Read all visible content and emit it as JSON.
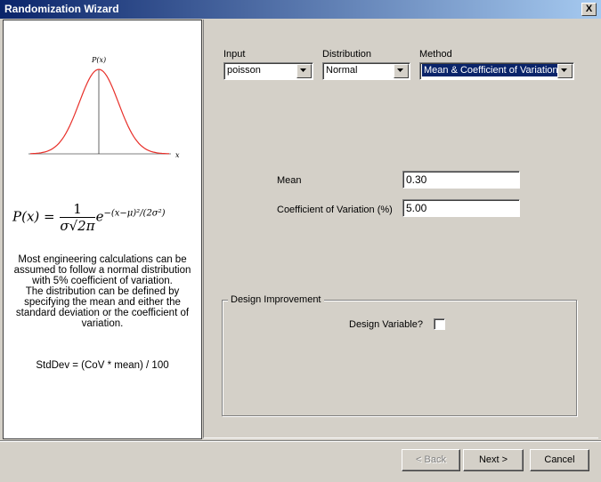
{
  "window": {
    "title": "Randomization Wizard",
    "close_glyph": "X"
  },
  "left": {
    "plot": {
      "ylabel": "P(x)",
      "xlabel": "x"
    },
    "formula": {
      "lhs": "P(x) =",
      "numerator": "1",
      "denominator": "σ√2π",
      "exp_base": "e",
      "exponent": "−(x−μ)²/(2σ²)"
    },
    "description": [
      "Most engineering calculations can be assumed to follow a normal distribution with 5% coefficient of variation.",
      "The distribution can be defined by specifying the mean and either the standard deviation or the coefficient of variation."
    ],
    "stddev_formula": "StdDev = (CoV * mean)  / 100"
  },
  "form": {
    "input": {
      "label": "Input",
      "value": "poisson"
    },
    "distribution": {
      "label": "Distribution",
      "value": "Normal"
    },
    "method": {
      "label": "Method",
      "value": "Mean & Coefficient of Variation"
    },
    "mean": {
      "label": "Mean",
      "value": "0.30"
    },
    "cov": {
      "label": "Coefficient of Variation (%)",
      "value": "5.00"
    }
  },
  "design": {
    "title": "Design Improvement",
    "checkbox_label": "Design Variable?",
    "checked": false
  },
  "buttons": {
    "back": "< Back",
    "next": "Next >",
    "cancel": "Cancel"
  }
}
